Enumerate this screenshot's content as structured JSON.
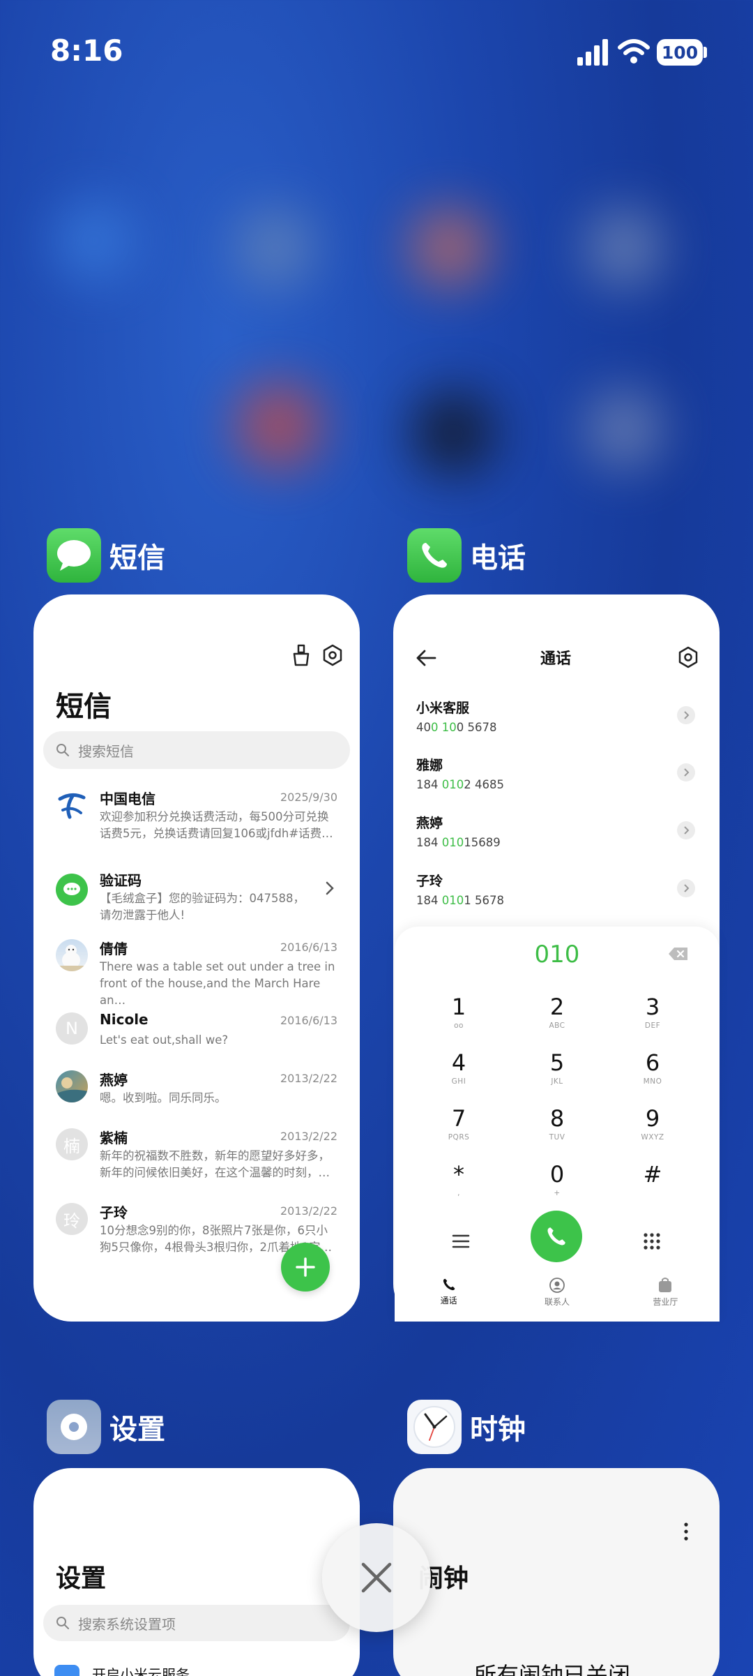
{
  "status": {
    "time": "8:16",
    "battery": "100"
  },
  "apps": [
    {
      "name": "短信"
    },
    {
      "name": "电话"
    },
    {
      "name": "设置"
    },
    {
      "name": "时钟"
    }
  ],
  "messages": {
    "title": "短信",
    "search_placeholder": "搜索短信",
    "items": [
      {
        "name": "中国电信",
        "date": "2025/9/30",
        "preview": "欢迎参加积分兑换话费活动，每500分可兑换话费5元，兑换话费请回复106或jfdh#话费…"
      },
      {
        "name": "验证码",
        "date": "",
        "preview": "【毛绒盒子】您的验证码为：047588，请勿泄露于他人!"
      },
      {
        "name": "倩倩",
        "date": "2016/6/13",
        "preview": "There was a table set out under a tree in front of the house,and the March Hare an…"
      },
      {
        "name": "Nicole",
        "date": "2016/6/13",
        "preview": "Let's eat out,shall we?",
        "avatar_letter": "N"
      },
      {
        "name": "燕婷",
        "date": "2013/2/22",
        "preview": "嗯。收到啦。同乐同乐。"
      },
      {
        "name": "紫楠",
        "date": "2013/2/22",
        "preview": "新年的祝福数不胜数，新年的愿望好多好多，新年的问候依旧美好，在这个温馨的时刻，…",
        "avatar_letter": "楠"
      },
      {
        "name": "子玲",
        "date": "2013/2/22",
        "preview": "10分想念9别的你，8张照片7张是你，6只小狗5只像你，4根骨头3根归你，2爪着地1定…",
        "avatar_letter": "玲"
      }
    ]
  },
  "phone": {
    "title": "通话",
    "contacts": [
      {
        "name": "小米客服",
        "num_a": "40",
        "num_hl_1": "0",
        "num_b": " ",
        "num_hl_2": "10",
        "num_c": "0 5678"
      },
      {
        "name": "雅娜",
        "num_a": "184 ",
        "num_hl_1": "010",
        "num_b": "2 4685",
        "num_hl_2": "",
        "num_c": ""
      },
      {
        "name": "燕婷",
        "num_a": "184 ",
        "num_hl_1": "010",
        "num_b": "15689",
        "num_hl_2": "",
        "num_c": ""
      },
      {
        "name": "子玲",
        "num_a": "184 ",
        "num_hl_1": "010",
        "num_b": "1 5678",
        "num_hl_2": "",
        "num_c": ""
      }
    ],
    "dial_input": "010",
    "keys": [
      {
        "d": "1",
        "l": "ᴏᴏ"
      },
      {
        "d": "2",
        "l": "ABC"
      },
      {
        "d": "3",
        "l": "DEF"
      },
      {
        "d": "4",
        "l": "GHI"
      },
      {
        "d": "5",
        "l": "JKL"
      },
      {
        "d": "6",
        "l": "MNO"
      },
      {
        "d": "7",
        "l": "PQRS"
      },
      {
        "d": "8",
        "l": "TUV"
      },
      {
        "d": "9",
        "l": "WXYZ"
      },
      {
        "d": "*",
        "l": ","
      },
      {
        "d": "0",
        "l": "+"
      },
      {
        "d": "#",
        "l": ""
      }
    ],
    "tabs": [
      {
        "label": "通话"
      },
      {
        "label": "联系人"
      },
      {
        "label": "营业厅"
      }
    ]
  },
  "settings": {
    "title": "设置",
    "search_placeholder": "搜索系统设置项",
    "first_item": "开启小米云服务"
  },
  "clock": {
    "title": "闹钟",
    "status": "所有闹钟已关闭"
  },
  "colors": {
    "accent_green": "#3dc34a",
    "background_blue": "#1c46ad"
  }
}
